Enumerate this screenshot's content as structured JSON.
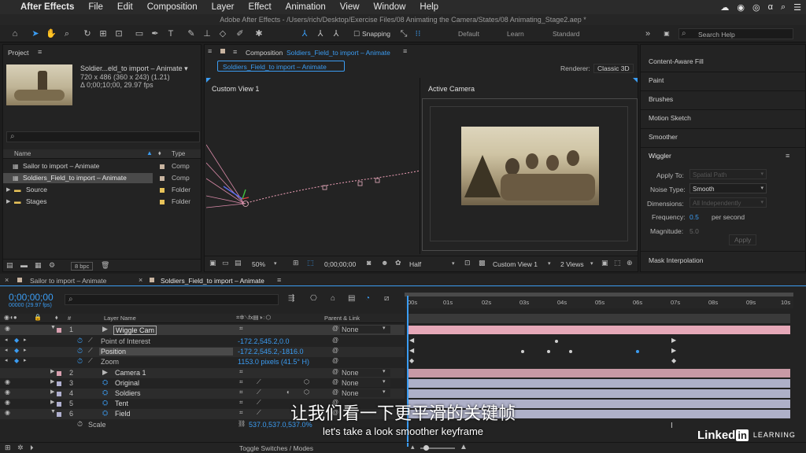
{
  "menubar": {
    "app": "After Effects",
    "items": [
      "File",
      "Edit",
      "Composition",
      "Layer",
      "Effect",
      "Animation",
      "View",
      "Window",
      "Help"
    ]
  },
  "titlebar": {
    "text": "Adobe After Effects - /Users/rich/Desktop/Exercise Files/08 Animating the Camera/States/08 Animating_Stage2.aep *"
  },
  "toolbar": {
    "snapping": "Snapping",
    "workspaces": [
      "Default",
      "Learn",
      "Standard"
    ],
    "search_placeholder": "Search Help"
  },
  "project": {
    "title": "Project",
    "selected_name": "Soldier...eld_to import – Animate ▾",
    "selected_dims": "720 x 486  (360 x 243) (1.21)",
    "selected_duration": "Δ 0;00;10;00, 29.97 fps",
    "search_placeholder": "",
    "col_name": "Name",
    "col_type": "Type",
    "items": [
      {
        "name": "Sailor to import – Animate",
        "type": "Comp",
        "color": "#c8b4a0",
        "folder": false
      },
      {
        "name": "Soldiers_Field_to import – Animate",
        "type": "Comp",
        "color": "#c8b4a0",
        "folder": false
      },
      {
        "name": "Source",
        "type": "Folder",
        "color": "#e8c35a",
        "folder": true
      },
      {
        "name": "Stages",
        "type": "Folder",
        "color": "#e8c35a",
        "folder": true
      }
    ],
    "bpc": "8 bpc"
  },
  "comp": {
    "title_prefix": "Composition",
    "title_name": "Soldiers_Field_to import – Animate",
    "tab": "Soldiers_Field_to import – Animate",
    "renderer_label": "Renderer:",
    "renderer_value": "Classic 3D",
    "view_left": "Custom View 1",
    "view_right": "Active Camera",
    "footer": {
      "zoom": "50%",
      "timecode": "0;00;00;00",
      "resolution": "Half",
      "view": "Custom View 1",
      "views": "2 Views"
    }
  },
  "right_panel": {
    "items": [
      "Content-Aware Fill",
      "Paint",
      "Brushes",
      "Motion Sketch",
      "Smoother"
    ],
    "wiggler": {
      "title": "Wiggler",
      "apply_to_label": "Apply To:",
      "apply_to_value": "Spatial Path",
      "noise_type_label": "Noise Type:",
      "noise_type_value": "Smooth",
      "dimensions_label": "Dimensions:",
      "dimensions_value": "All Independently",
      "frequency_label": "Frequency:",
      "frequency_value": "0.5",
      "frequency_unit": "per second",
      "magnitude_label": "Magnitude:",
      "magnitude_value": "5.0",
      "apply_button": "Apply"
    },
    "mask_interpolation": "Mask Interpolation"
  },
  "timeline": {
    "tabs": [
      "Sailor to import – Animate",
      "Soldiers_Field_to import – Animate"
    ],
    "timecode": "0;00;00;00",
    "fps": "00000 (29.97 fps)",
    "col_layer_name": "Layer Name",
    "col_parent": "Parent & Link",
    "ruler": [
      "00s",
      "01s",
      "02s",
      "03s",
      "04s",
      "05s",
      "06s",
      "07s",
      "08s",
      "09s",
      "10s"
    ],
    "layers": [
      {
        "num": "1",
        "name": "Wiggle Cam",
        "parent": "None",
        "color": "#d9a0b0",
        "type": "camera"
      },
      {
        "num": "2",
        "name": "Camera 1",
        "parent": "None",
        "color": "#d9a0b0",
        "type": "camera"
      },
      {
        "num": "3",
        "name": "Original",
        "parent": "None",
        "color": "#b0b0d0",
        "type": "footage"
      },
      {
        "num": "4",
        "name": "Soldiers",
        "parent": "None",
        "color": "#b0b0d0",
        "type": "footage"
      },
      {
        "num": "5",
        "name": "Tent",
        "parent": "None",
        "color": "#b0b0d0",
        "type": "footage"
      },
      {
        "num": "6",
        "name": "Field",
        "parent": "None",
        "color": "#b0b0d0",
        "type": "footage"
      }
    ],
    "properties": [
      {
        "name": "Point of Interest",
        "value": "-172.2,545.2,0.0"
      },
      {
        "name": "Position",
        "value": "-172.2,545.2,-1816.0"
      },
      {
        "name": "Zoom",
        "value": "1153.0 pixels (41.5° H)"
      }
    ],
    "scale": {
      "name": "Scale",
      "value": "537.0,537.0,537.0%"
    },
    "toggle_label": "Toggle Switches / Modes"
  },
  "subtitles": {
    "chinese": "让我们看一下更平滑的关键帧",
    "english": "let's take a look smoother keyframe"
  },
  "watermark": {
    "brand": "Linked",
    "brand_in": "in",
    "suffix": "LEARNING"
  }
}
